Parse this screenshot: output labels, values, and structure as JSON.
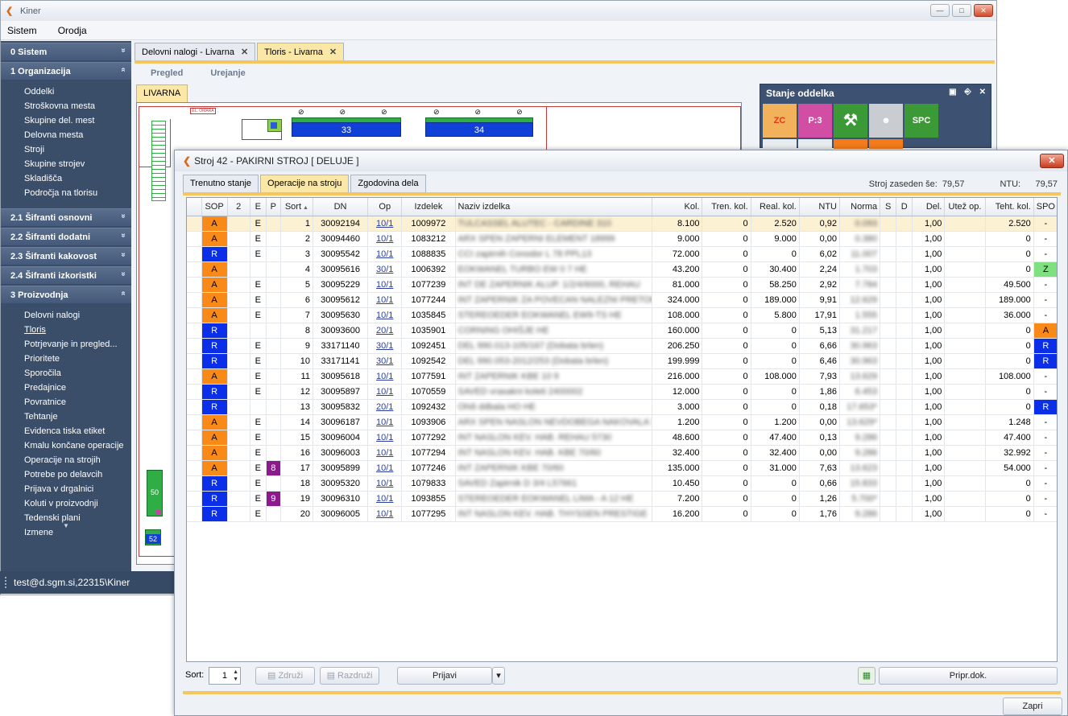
{
  "app": {
    "title": "Kiner",
    "menu": [
      "Sistem",
      "Orodja"
    ]
  },
  "sidebar": {
    "groups": [
      {
        "label": "0 Sistem",
        "chevron": "»",
        "items": []
      },
      {
        "label": "1 Organizacija",
        "chevron": "«",
        "items": [
          "Oddelki",
          "Stroškovna mesta",
          "Skupine del. mest",
          "Delovna mesta",
          "Stroji",
          "Skupine strojev",
          "Skladišča",
          "Področja na tlorisu"
        ]
      },
      {
        "label": "2.1 Šifranti osnovni",
        "chevron": "»",
        "items": []
      },
      {
        "label": "2.2 Šifranti dodatni",
        "chevron": "»",
        "items": []
      },
      {
        "label": "2.3 Šifranti kakovost",
        "chevron": "»",
        "items": []
      },
      {
        "label": "2.4 Šifranti izkoristki",
        "chevron": "»",
        "items": []
      },
      {
        "label": "3 Proizvodnja",
        "chevron": "«",
        "items": [
          "Delovni nalogi",
          "Tloris",
          "Potrjevanje in pregled...",
          "Prioritete",
          "Sporočila",
          "Predajnice",
          "Povratnice",
          "Tehtanje",
          "Evidenca tiska etiket",
          "Kmalu končane operacije",
          "Operacije na strojih",
          "Potrebe po delavcih",
          "Prijava v drgalnici",
          "Koluti v proizvodnji",
          "Tedenski plani",
          "Izmene"
        ]
      }
    ]
  },
  "status": {
    "user": "test@d.sgm.si,22315\\Kiner"
  },
  "doc_tabs": [
    "Delovni nalogi - Livarna",
    "Tloris - Livarna"
  ],
  "subnav": [
    "Pregled",
    "Urejanje"
  ],
  "floor": {
    "tab": "LIVARNA",
    "machines": [
      "33",
      "34",
      "50",
      "52"
    ],
    "label_tag": "EL. OMARA"
  },
  "stanje": {
    "title": "Stanje oddelka",
    "tiles": [
      "ZC",
      "P:3",
      "SPC"
    ],
    "colors": {
      "zc": "#f2b25c",
      "p3": "#d24ea5",
      "green": "#3c9a36"
    }
  },
  "dialog": {
    "title": "Stroj 42 - PAKIRNI STROJ [ DELUJE ]",
    "tabs": [
      "Trenutno stanje",
      "Operacije na stroju",
      "Zgodovina dela"
    ],
    "info_label": "Stroj zaseden še:",
    "info_value": "79,57",
    "ntu_label": "NTU:",
    "ntu_value": "79,57",
    "columns": [
      "SOP",
      "2",
      "E",
      "P",
      "Sort",
      "DN",
      "Op",
      "Izdelek",
      "Naziv izdelka",
      "Kol.",
      "Tren. kol.",
      "Real. kol.",
      "NTU",
      "Norma",
      "S",
      "D",
      "Del.",
      "Utež op.",
      "Teht. kol.",
      "SPO"
    ],
    "sort_value": "1",
    "buttons": {
      "zdruzi": "Združi",
      "razdruzi": "Razdruži",
      "prijavi": "Prijavi",
      "pripr": "Pripr.dok.",
      "zapri": "Zapri"
    },
    "sort_label": "Sort:"
  },
  "rows": [
    {
      "sop": "A",
      "e": "E",
      "p": "",
      "sort": "1",
      "dn": "30092194",
      "op": "10/1",
      "izd": "1009972",
      "naziv": "TULCASSEL ALUTEC - CARDINE 310",
      "kol": "8.100",
      "tren": "0",
      "real": "2.520",
      "ntu": "0,92",
      "norma": "0.093",
      "del": "1,00",
      "teht": "2.520",
      "spo": "-"
    },
    {
      "sop": "A",
      "e": "E",
      "p": "",
      "sort": "2",
      "dn": "30094460",
      "op": "10/1",
      "izd": "1083212",
      "naziv": "ARX SPEN ZAPERNI ELEMENT 18999",
      "kol": "9.000",
      "tren": "0",
      "real": "9.000",
      "ntu": "0,00",
      "norma": "0.380",
      "del": "1,00",
      "teht": "0",
      "spo": "-"
    },
    {
      "sop": "R",
      "e": "E",
      "p": "",
      "sort": "3",
      "dn": "30095542",
      "op": "10/1",
      "izd": "1088835",
      "naziv": "CCI zapirnih Conodor L 78 PPL13",
      "kol": "72.000",
      "tren": "0",
      "real": "0",
      "ntu": "6,02",
      "norma": "11.007",
      "del": "1,00",
      "teht": "0",
      "spo": "-"
    },
    {
      "sop": "A",
      "e": "",
      "p": "",
      "sort": "4",
      "dn": "30095616",
      "op": "30/1",
      "izd": "1006392",
      "naziv": "EOKWANEL TURBO EW 0 7 HE",
      "kol": "43.200",
      "tren": "0",
      "real": "30.400",
      "ntu": "2,24",
      "norma": "1.703",
      "del": "1,00",
      "teht": "0",
      "spo": "Z"
    },
    {
      "sop": "A",
      "e": "E",
      "p": "",
      "sort": "5",
      "dn": "30095229",
      "op": "10/1",
      "izd": "1077239",
      "naziv": "INT DE ZAPERNIK ALUP. 1/2/4/6000, REHAU",
      "kol": "81.000",
      "tren": "0",
      "real": "58.250",
      "ntu": "2,92",
      "norma": "7.784",
      "del": "1,00",
      "teht": "49.500",
      "spo": "-"
    },
    {
      "sop": "A",
      "e": "E",
      "p": "",
      "sort": "6",
      "dn": "30095612",
      "op": "10/1",
      "izd": "1077244",
      "naziv": "INT ZAPERNIK ZA POVECAN NALEZNI PRETOK",
      "kol": "324.000",
      "tren": "0",
      "real": "189.000",
      "ntu": "9,91",
      "norma": "12.629",
      "del": "1,00",
      "teht": "189.000",
      "spo": "-"
    },
    {
      "sop": "A",
      "e": "E",
      "p": "",
      "sort": "7",
      "dn": "30095630",
      "op": "10/1",
      "izd": "1035845",
      "naziv": "STEREOEDER EOKWANEL EW9-TS HE",
      "kol": "108.000",
      "tren": "0",
      "real": "5.800",
      "ntu": "17,91",
      "norma": "1.555",
      "del": "1,00",
      "teht": "36.000",
      "spo": "-"
    },
    {
      "sop": "R",
      "e": "",
      "p": "",
      "sort": "8",
      "dn": "30093600",
      "op": "20/1",
      "izd": "1035901",
      "naziv": "CORNING OHIŠJE HE",
      "kol": "160.000",
      "tren": "0",
      "real": "0",
      "ntu": "5,13",
      "norma": "31.217",
      "del": "1,00",
      "teht": "0",
      "spo": "A"
    },
    {
      "sop": "R",
      "e": "E",
      "p": "",
      "sort": "9",
      "dn": "33171140",
      "op": "30/1",
      "izd": "1092451",
      "naziv": "DEL 990.013-105/167 (Dobata brlen)",
      "kol": "206.250",
      "tren": "0",
      "real": "0",
      "ntu": "6,66",
      "norma": "30.963",
      "del": "1,00",
      "teht": "0",
      "spo": "R"
    },
    {
      "sop": "R",
      "e": "E",
      "p": "",
      "sort": "10",
      "dn": "33171141",
      "op": "30/1",
      "izd": "1092542",
      "naziv": "DEL 990.053-2012/253 (Dobata brlen)",
      "kol": "199.999",
      "tren": "0",
      "real": "0",
      "ntu": "6,46",
      "norma": "30.963",
      "del": "1,00",
      "teht": "0",
      "spo": "R"
    },
    {
      "sop": "A",
      "e": "E",
      "p": "",
      "sort": "11",
      "dn": "30095618",
      "op": "10/1",
      "izd": "1077591",
      "naziv": "INT ZAPERNIK KBE 10 9",
      "kol": "216.000",
      "tren": "0",
      "real": "108.000",
      "ntu": "7,93",
      "norma": "13.629",
      "del": "1,00",
      "teht": "108.000",
      "spo": "-"
    },
    {
      "sop": "R",
      "e": "E",
      "p": "",
      "sort": "12",
      "dn": "30095897",
      "op": "10/1",
      "izd": "1070559",
      "naziv": "SAVED vrasakni koleti 2400002",
      "kol": "12.000",
      "tren": "0",
      "real": "0",
      "ntu": "1,86",
      "norma": "6.453",
      "del": "1,00",
      "teht": "0",
      "spo": "-"
    },
    {
      "sop": "R",
      "e": "",
      "p": "",
      "sort": "13",
      "dn": "30095832",
      "op": "20/1",
      "izd": "1092432",
      "naziv": "Ohiš ddbala HO HE",
      "kol": "3.000",
      "tren": "0",
      "real": "0",
      "ntu": "0,18",
      "norma": "17.653*",
      "del": "1,00",
      "teht": "0",
      "spo": "R"
    },
    {
      "sop": "A",
      "e": "E",
      "p": "",
      "sort": "14",
      "dn": "30096187",
      "op": "10/1",
      "izd": "1093906",
      "naziv": "ARX SPEN NASLON NEVDOBEGA NAKOVALA 720",
      "kol": "1.200",
      "tren": "0",
      "real": "1.200",
      "ntu": "0,00",
      "norma": "13.629*",
      "del": "1,00",
      "teht": "1.248",
      "spo": "-"
    },
    {
      "sop": "A",
      "e": "E",
      "p": "",
      "sort": "15",
      "dn": "30096004",
      "op": "10/1",
      "izd": "1077292",
      "naziv": "INT NASLON KEV. HAB. REHAU 5730",
      "kol": "48.600",
      "tren": "0",
      "real": "47.400",
      "ntu": "0,13",
      "norma": "9.286",
      "del": "1,00",
      "teht": "47.400",
      "spo": "-"
    },
    {
      "sop": "A",
      "e": "E",
      "p": "",
      "sort": "16",
      "dn": "30096003",
      "op": "10/1",
      "izd": "1077294",
      "naziv": "INT NASLON KEV. HAB. KBE 70/60",
      "kol": "32.400",
      "tren": "0",
      "real": "32.400",
      "ntu": "0,00",
      "norma": "9.286",
      "del": "1,00",
      "teht": "32.992",
      "spo": "-"
    },
    {
      "sop": "A",
      "e": "E",
      "p": "8",
      "sort": "17",
      "dn": "30095899",
      "op": "10/1",
      "izd": "1077246",
      "naziv": "INT ZAPERNIK KBE 70/60",
      "kol": "135.000",
      "tren": "0",
      "real": "31.000",
      "ntu": "7,63",
      "norma": "13.623",
      "del": "1,00",
      "teht": "54.000",
      "spo": "-"
    },
    {
      "sop": "R",
      "e": "E",
      "p": "",
      "sort": "18",
      "dn": "30095320",
      "op": "10/1",
      "izd": "1079833",
      "naziv": "SAVED Zapirnik D 3/4 L57661",
      "kol": "10.450",
      "tren": "0",
      "real": "0",
      "ntu": "0,66",
      "norma": "15.833",
      "del": "1,00",
      "teht": "0",
      "spo": "-"
    },
    {
      "sop": "R",
      "e": "E",
      "p": "9",
      "sort": "19",
      "dn": "30096310",
      "op": "10/1",
      "izd": "1093855",
      "naziv": "STEREOEDER EOKWANEL LIMA - A 12 HE",
      "kol": "7.200",
      "tren": "0",
      "real": "0",
      "ntu": "1,26",
      "norma": "5.700*",
      "del": "1,00",
      "teht": "0",
      "spo": "-"
    },
    {
      "sop": "R",
      "e": "E",
      "p": "",
      "sort": "20",
      "dn": "30096005",
      "op": "10/1",
      "izd": "1077295",
      "naziv": "INT NASLON KEV. HAB. THYSSEN PRESTIGE",
      "kol": "16.200",
      "tren": "0",
      "real": "0",
      "ntu": "1,76",
      "norma": "9.286",
      "del": "1,00",
      "teht": "0",
      "spo": "-"
    }
  ]
}
